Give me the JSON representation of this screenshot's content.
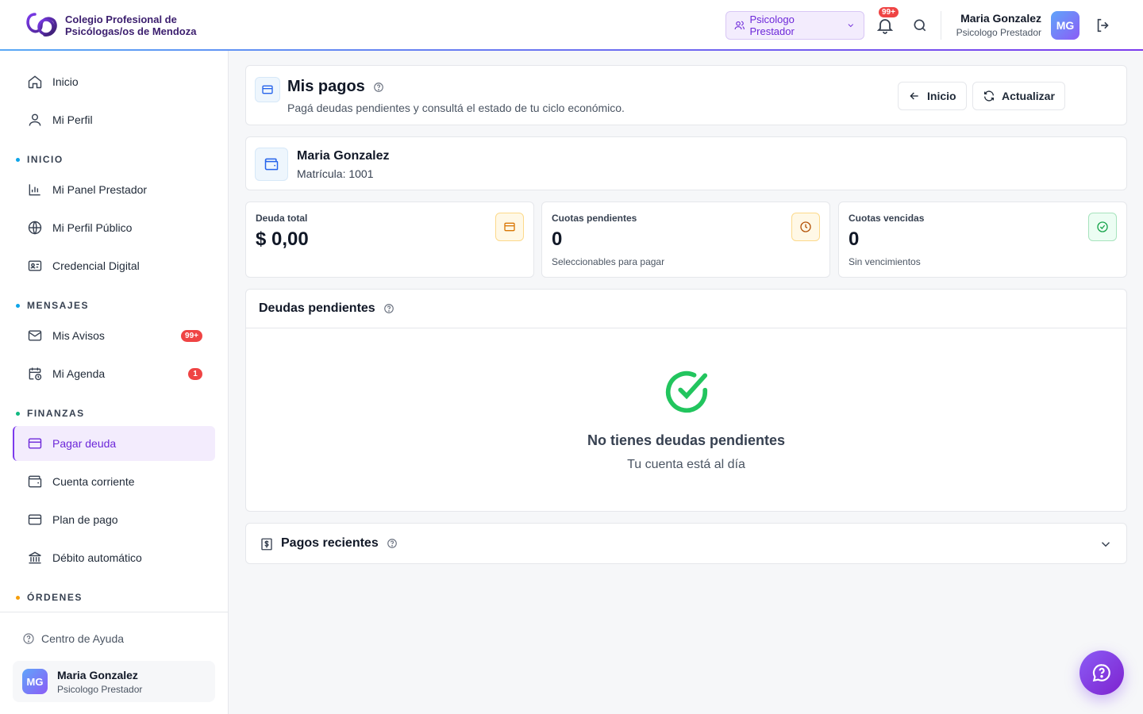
{
  "header": {
    "org_name_line1": "Colegio Profesional de",
    "org_name_line2": "Psicólogas/os de Mendoza",
    "role_selector": "Psicologo Prestador",
    "notifications_badge": "99+",
    "user_name": "Maria Gonzalez",
    "user_role": "Psicologo Prestador",
    "avatar_initials": "MG"
  },
  "sidebar": {
    "items_top": [
      {
        "label": "Inicio",
        "icon": "home-icon"
      },
      {
        "label": "Mi Perfil",
        "icon": "user-icon"
      }
    ],
    "sections": [
      {
        "label": "INICIO",
        "color": "#0ea5e9",
        "items": [
          {
            "label": "Mi Panel Prestador",
            "icon": "bar-chart-icon"
          },
          {
            "label": "Mi Perfil Público",
            "icon": "globe-icon"
          },
          {
            "label": "Credencial Digital",
            "icon": "id-card-icon"
          }
        ]
      },
      {
        "label": "MENSAJES",
        "color": "#0ea5e9",
        "items": [
          {
            "label": "Mis Avisos",
            "icon": "mail-icon",
            "badge": "99+"
          },
          {
            "label": "Mi Agenda",
            "icon": "calendar-clock-icon",
            "badge": "1"
          }
        ]
      },
      {
        "label": "FINANZAS",
        "color": "#10b981",
        "items": [
          {
            "label": "Pagar deuda",
            "icon": "credit-card-icon",
            "active": true
          },
          {
            "label": "Cuenta corriente",
            "icon": "wallet-icon"
          },
          {
            "label": "Plan de pago",
            "icon": "credit-card-icon"
          },
          {
            "label": "Débito automático",
            "icon": "bank-icon"
          }
        ]
      },
      {
        "label": "ÓRDENES",
        "color": "#f59e0b",
        "items": []
      }
    ],
    "help_link": "Centro de Ayuda",
    "user_name": "Maria Gonzalez",
    "user_role": "Psicologo Prestador",
    "avatar_initials": "MG"
  },
  "page": {
    "title": "Mis pagos",
    "subtitle": "Pagá deudas pendientes y consultá el estado de tu ciclo económico.",
    "btn_home": "Inicio",
    "btn_refresh": "Actualizar"
  },
  "account": {
    "name": "Maria Gonzalez",
    "registration": "Matrícula: 1001"
  },
  "stats": [
    {
      "label": "Deuda total",
      "value": "$ 0,00",
      "note": "",
      "icon": "credit-card-icon",
      "accent": "#f59e0b"
    },
    {
      "label": "Cuotas pendientes",
      "value": "0",
      "note": "Seleccionables para pagar",
      "icon": "clock-icon",
      "accent": "#d97706"
    },
    {
      "label": "Cuotas vencidas",
      "value": "0",
      "note": "Sin vencimientos",
      "icon": "check-circle-icon",
      "accent": "#16a34a"
    }
  ],
  "pending_debts": {
    "title": "Deudas pendientes",
    "empty_title": "No tienes deudas pendientes",
    "empty_sub": "Tu cuenta está al día"
  },
  "recent_payments": {
    "title": "Pagos recientes"
  }
}
